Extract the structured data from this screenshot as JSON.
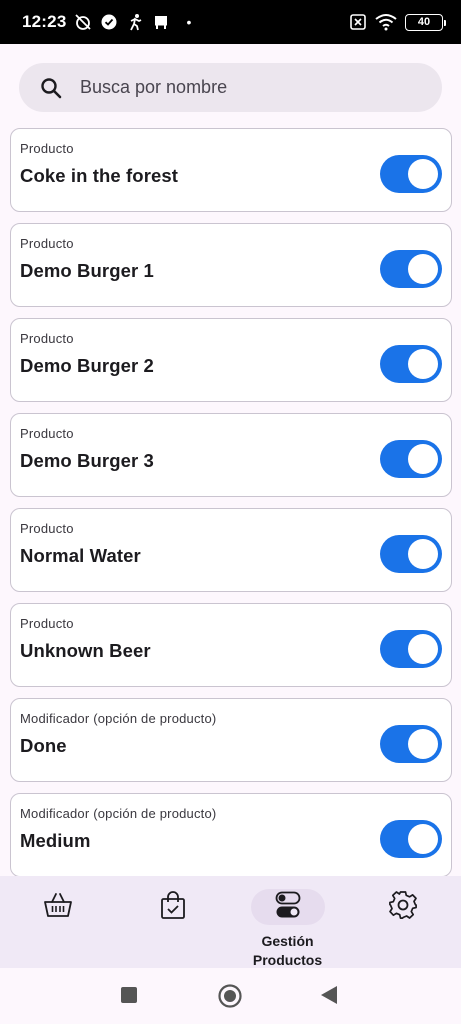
{
  "status_bar": {
    "time": "12:23",
    "icons_left": [
      "alarm-off-icon",
      "check-circle-icon",
      "runner-icon",
      "storefront-icon"
    ],
    "dot": "•",
    "icons_right": [
      "no-sim-icon",
      "wifi-icon",
      "battery-icon"
    ],
    "battery_level": "40"
  },
  "search": {
    "placeholder": "Busca por nombre",
    "icon": "search-icon"
  },
  "items": [
    {
      "kind": "Producto",
      "name": "Coke in the forest",
      "enabled": true
    },
    {
      "kind": "Producto",
      "name": "Demo Burger 1",
      "enabled": true
    },
    {
      "kind": "Producto",
      "name": "Demo Burger 2",
      "enabled": true
    },
    {
      "kind": "Producto",
      "name": "Demo Burger 3",
      "enabled": true
    },
    {
      "kind": "Producto",
      "name": "Normal Water",
      "enabled": true
    },
    {
      "kind": "Producto",
      "name": "Unknown Beer",
      "enabled": true
    },
    {
      "kind": "Modificador (opción de producto)",
      "name": "Done",
      "enabled": true
    },
    {
      "kind": "Modificador (opción de producto)",
      "name": "Medium",
      "enabled": true
    }
  ],
  "bottom_nav": {
    "items": [
      {
        "icon": "basket-icon",
        "label": ""
      },
      {
        "icon": "shopping-bag-check-icon",
        "label": ""
      },
      {
        "icon": "toggles-icon",
        "label": "Gestión\nProductos",
        "active": true
      },
      {
        "icon": "gear-icon",
        "label": ""
      }
    ],
    "active_label_line1": "Gestión",
    "active_label_line2": "Productos"
  },
  "system_nav": [
    "recents-square-icon",
    "home-circle-icon",
    "back-triangle-icon"
  ],
  "colors": {
    "toggle_on": "#1a73e8",
    "background": "#fdf7fd",
    "nav_background": "#f0e9f6",
    "search_background": "#ece6ee"
  }
}
